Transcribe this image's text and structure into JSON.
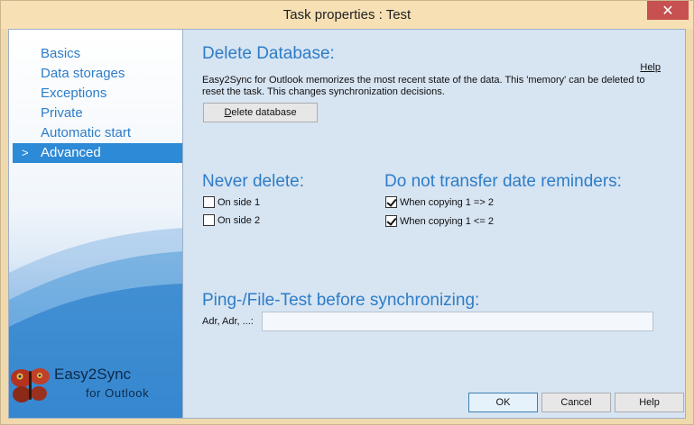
{
  "window": {
    "title": "Task properties : Test",
    "close_glyph": "✕"
  },
  "sidebar": {
    "items": [
      {
        "label": "Basics",
        "active": false
      },
      {
        "label": "Data storages",
        "active": false
      },
      {
        "label": "Exceptions",
        "active": false
      },
      {
        "label": "Private",
        "active": false
      },
      {
        "label": "Automatic start",
        "active": false
      },
      {
        "label": "Advanced",
        "active": true
      }
    ],
    "active_marker": ">",
    "logo_title": "Easy2Sync",
    "logo_subtitle": "for Outlook",
    "logo_icon": "butterfly-icon"
  },
  "main": {
    "delete_db": {
      "heading": "Delete Database:",
      "help_link": "Help",
      "description": "Easy2Sync for Outlook memorizes the most recent state of the data. This 'memory' can be deleted to reset the task. This changes synchronization decisions.",
      "button_underlined": "D",
      "button_rest": "elete database"
    },
    "never_delete": {
      "heading": "Never delete:",
      "options": [
        {
          "label": "On side 1",
          "checked": false
        },
        {
          "label": "On side 2",
          "checked": false
        }
      ]
    },
    "reminders": {
      "heading": "Do not transfer date reminders:",
      "options": [
        {
          "label": "When copying 1 => 2",
          "checked": true
        },
        {
          "label": "When copying 1 <= 2",
          "checked": true
        }
      ]
    },
    "ping": {
      "heading": "Ping-/File-Test before synchronizing:",
      "field_label": "Adr, Adr, ...:",
      "field_value": ""
    }
  },
  "footer": {
    "ok": "OK",
    "cancel": "Cancel",
    "help": "Help"
  },
  "colors": {
    "accent": "#2d7dc7",
    "active_nav": "#2d8ad6",
    "close_red": "#c75050"
  }
}
